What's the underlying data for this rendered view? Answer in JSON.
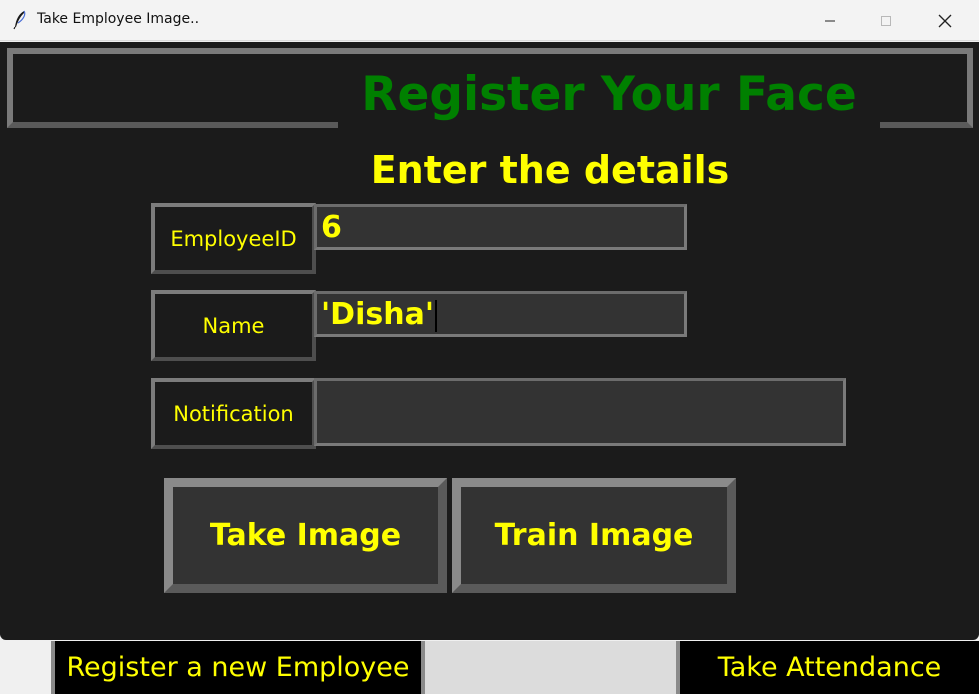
{
  "background_window": {
    "register_button_label": "Register a new Employee",
    "attendance_button_label": "Take Attendance"
  },
  "dialog": {
    "title": "Take Employee Image..",
    "window_controls": {
      "minimize": "—",
      "maximize": "☐",
      "close": "✕"
    },
    "header_title": "Register Your Face",
    "subtitle": "Enter the details",
    "fields": {
      "employee_id": {
        "label": "EmployeeID",
        "value": "6"
      },
      "name": {
        "label": "Name",
        "value": "'Disha'"
      },
      "notification": {
        "label": "Notification",
        "value": ""
      }
    },
    "buttons": {
      "take_image": "Take Image",
      "train_image": "Train Image"
    }
  },
  "colors": {
    "panel_bg": "#1b1b1b",
    "entry_bg": "#333333",
    "accent_text": "#ffff00",
    "header_text": "#008000",
    "border": "#7a7a7a"
  },
  "icons": {
    "app_icon": "feather-icon"
  }
}
